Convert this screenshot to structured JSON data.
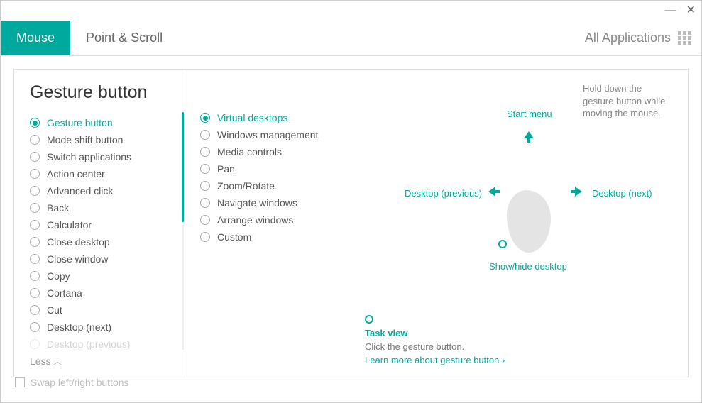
{
  "window": {
    "minimize": "—",
    "close": "✕"
  },
  "tabs": {
    "mouse": "Mouse",
    "pointScroll": "Point & Scroll"
  },
  "headerRight": "All Applications",
  "pageTitle": "Gesture button",
  "leftList": [
    {
      "label": "Gesture button",
      "selected": true
    },
    {
      "label": "Mode shift button"
    },
    {
      "label": "Switch applications"
    },
    {
      "label": "Action center"
    },
    {
      "label": "Advanced click"
    },
    {
      "label": "Back"
    },
    {
      "label": "Calculator"
    },
    {
      "label": "Close desktop"
    },
    {
      "label": "Close window"
    },
    {
      "label": "Copy"
    },
    {
      "label": "Cortana"
    },
    {
      "label": "Cut"
    },
    {
      "label": "Desktop (next)"
    },
    {
      "label": "Desktop (previous)",
      "faded": true
    }
  ],
  "lessLabel": "Less",
  "midList": [
    {
      "label": "Virtual desktops",
      "selected": true
    },
    {
      "label": "Windows management"
    },
    {
      "label": "Media controls"
    },
    {
      "label": "Pan"
    },
    {
      "label": "Zoom/Rotate"
    },
    {
      "label": "Navigate windows"
    },
    {
      "label": "Arrange windows"
    },
    {
      "label": "Custom"
    }
  ],
  "helpText": "Hold down the gesture button while moving the mouse.",
  "diagram": {
    "up": "Start menu",
    "left": "Desktop (previous)",
    "right": "Desktop (next)",
    "down": "Show/hide desktop"
  },
  "taskView": {
    "title": "Task view",
    "desc": "Click the gesture button.",
    "link": "Learn more about gesture button  ›"
  },
  "swapLabel": "Swap left/right buttons"
}
